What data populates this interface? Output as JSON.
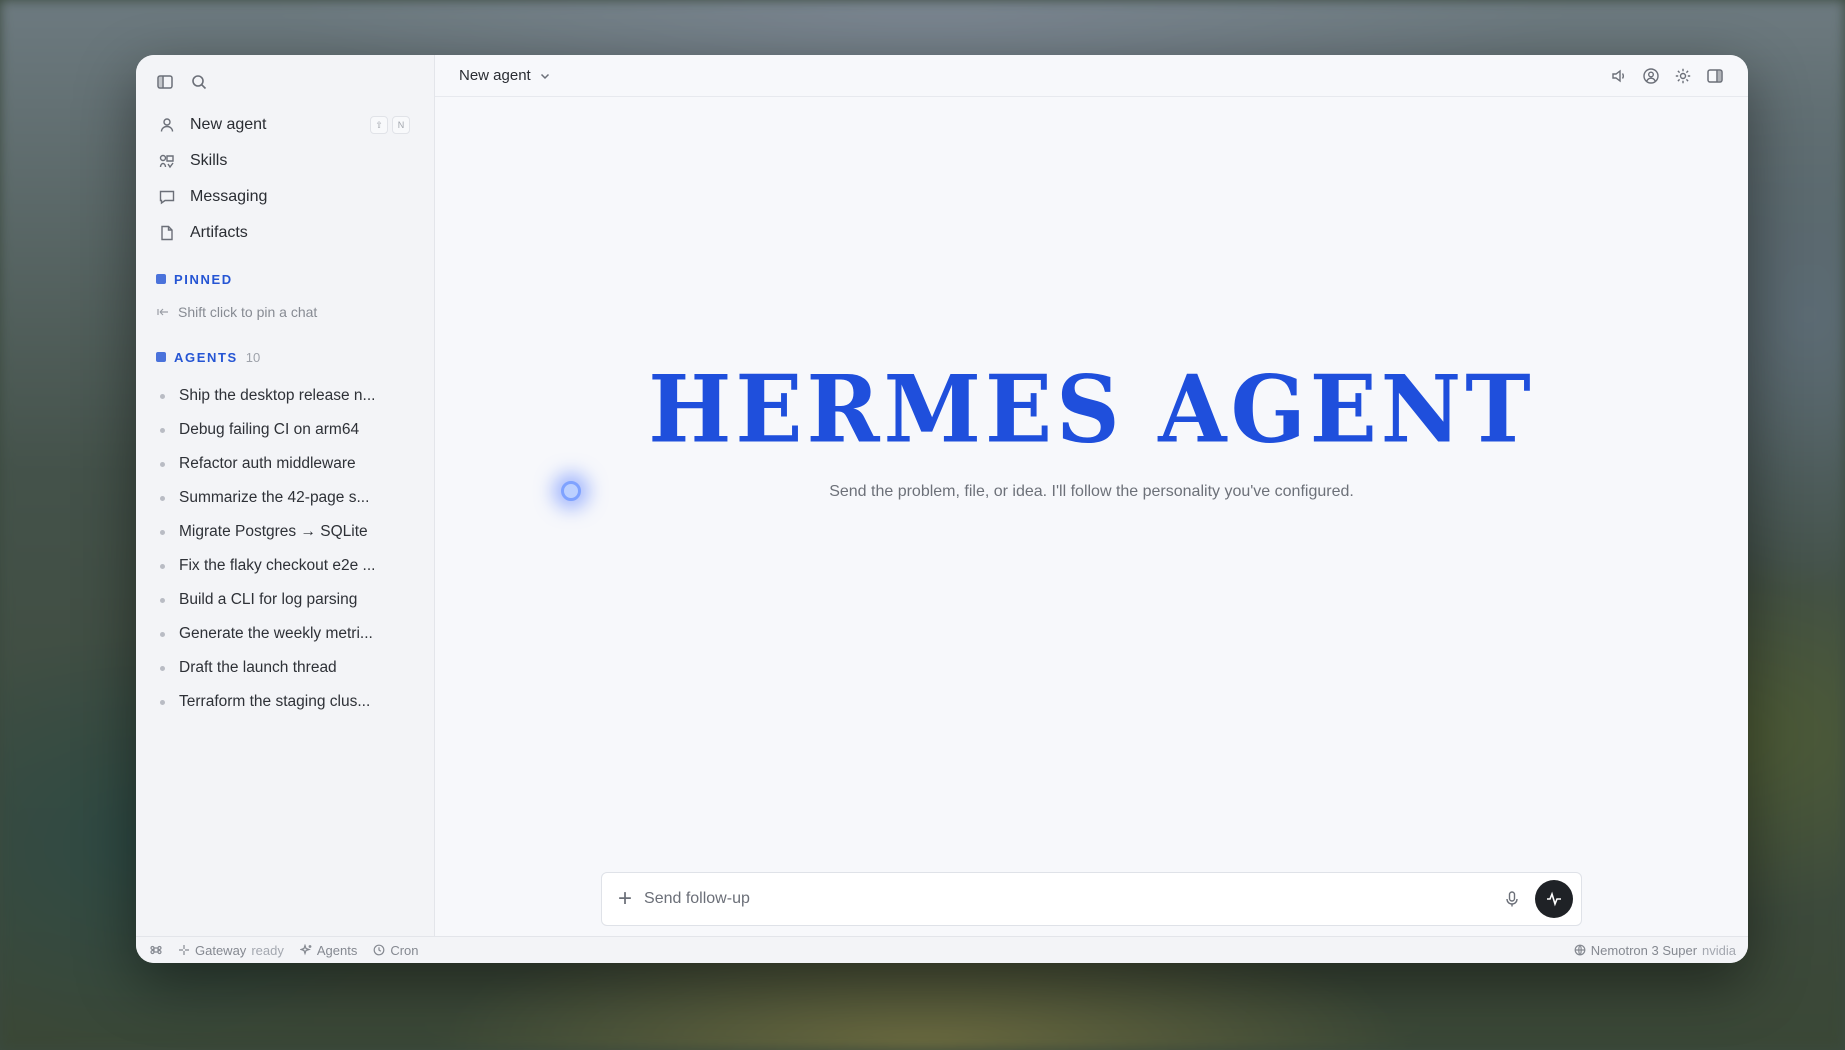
{
  "sidebar": {
    "nav": [
      {
        "label": "New agent",
        "icon": "user-icon"
      },
      {
        "label": "Skills",
        "icon": "skills-icon"
      },
      {
        "label": "Messaging",
        "icon": "chat-bubble-icon"
      },
      {
        "label": "Artifacts",
        "icon": "file-icon"
      }
    ],
    "new_agent_shortcut": [
      "⇧",
      "N"
    ],
    "pinned": {
      "title": "PINNED",
      "hint": "Shift click to pin a chat"
    },
    "agents": {
      "title": "AGENTS",
      "count": "10",
      "items": [
        "Ship the desktop release n...",
        "Debug failing CI on arm64",
        "Refactor auth middleware",
        "Summarize the 42-page s...",
        "Migrate Postgres → SQLite",
        "Fix the flaky checkout e2e ...",
        "Build a CLI for log parsing",
        "Generate the weekly metri...",
        "Draft the launch thread",
        "Terraform the staging clus..."
      ]
    }
  },
  "topbar": {
    "model_label": "New agent"
  },
  "hero": {
    "title": "HERMES AGENT",
    "subtitle": "Send the problem, file, or idea. I'll follow the personality you've configured."
  },
  "composer": {
    "placeholder": "Send follow-up"
  },
  "statusbar": {
    "gateway_label": "Gateway",
    "gateway_state": "ready",
    "agents_label": "Agents",
    "cron_label": "Cron",
    "model_name": "Nemotron 3 Super",
    "model_provider": "nvidia"
  },
  "colors": {
    "accent": "#1f4fdc",
    "section": "#2555d4",
    "send_button": "#1f2226"
  }
}
